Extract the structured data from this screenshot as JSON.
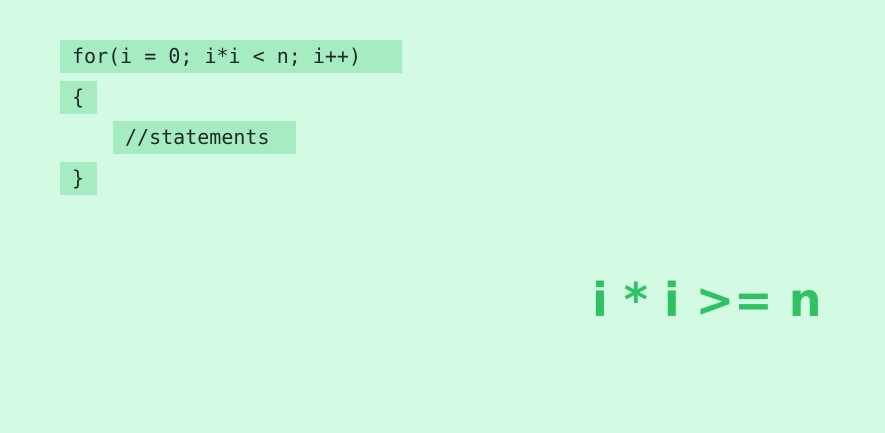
{
  "code": {
    "lines": [
      "for(i = 0; i*i < n; i++)",
      "{",
      "//statements",
      "}"
    ]
  },
  "condition": {
    "text": "i * i >= n"
  },
  "colors": {
    "background": "#d3fbe3",
    "code_highlight": "#a6ecc3",
    "condition_text": "#2ec263"
  }
}
